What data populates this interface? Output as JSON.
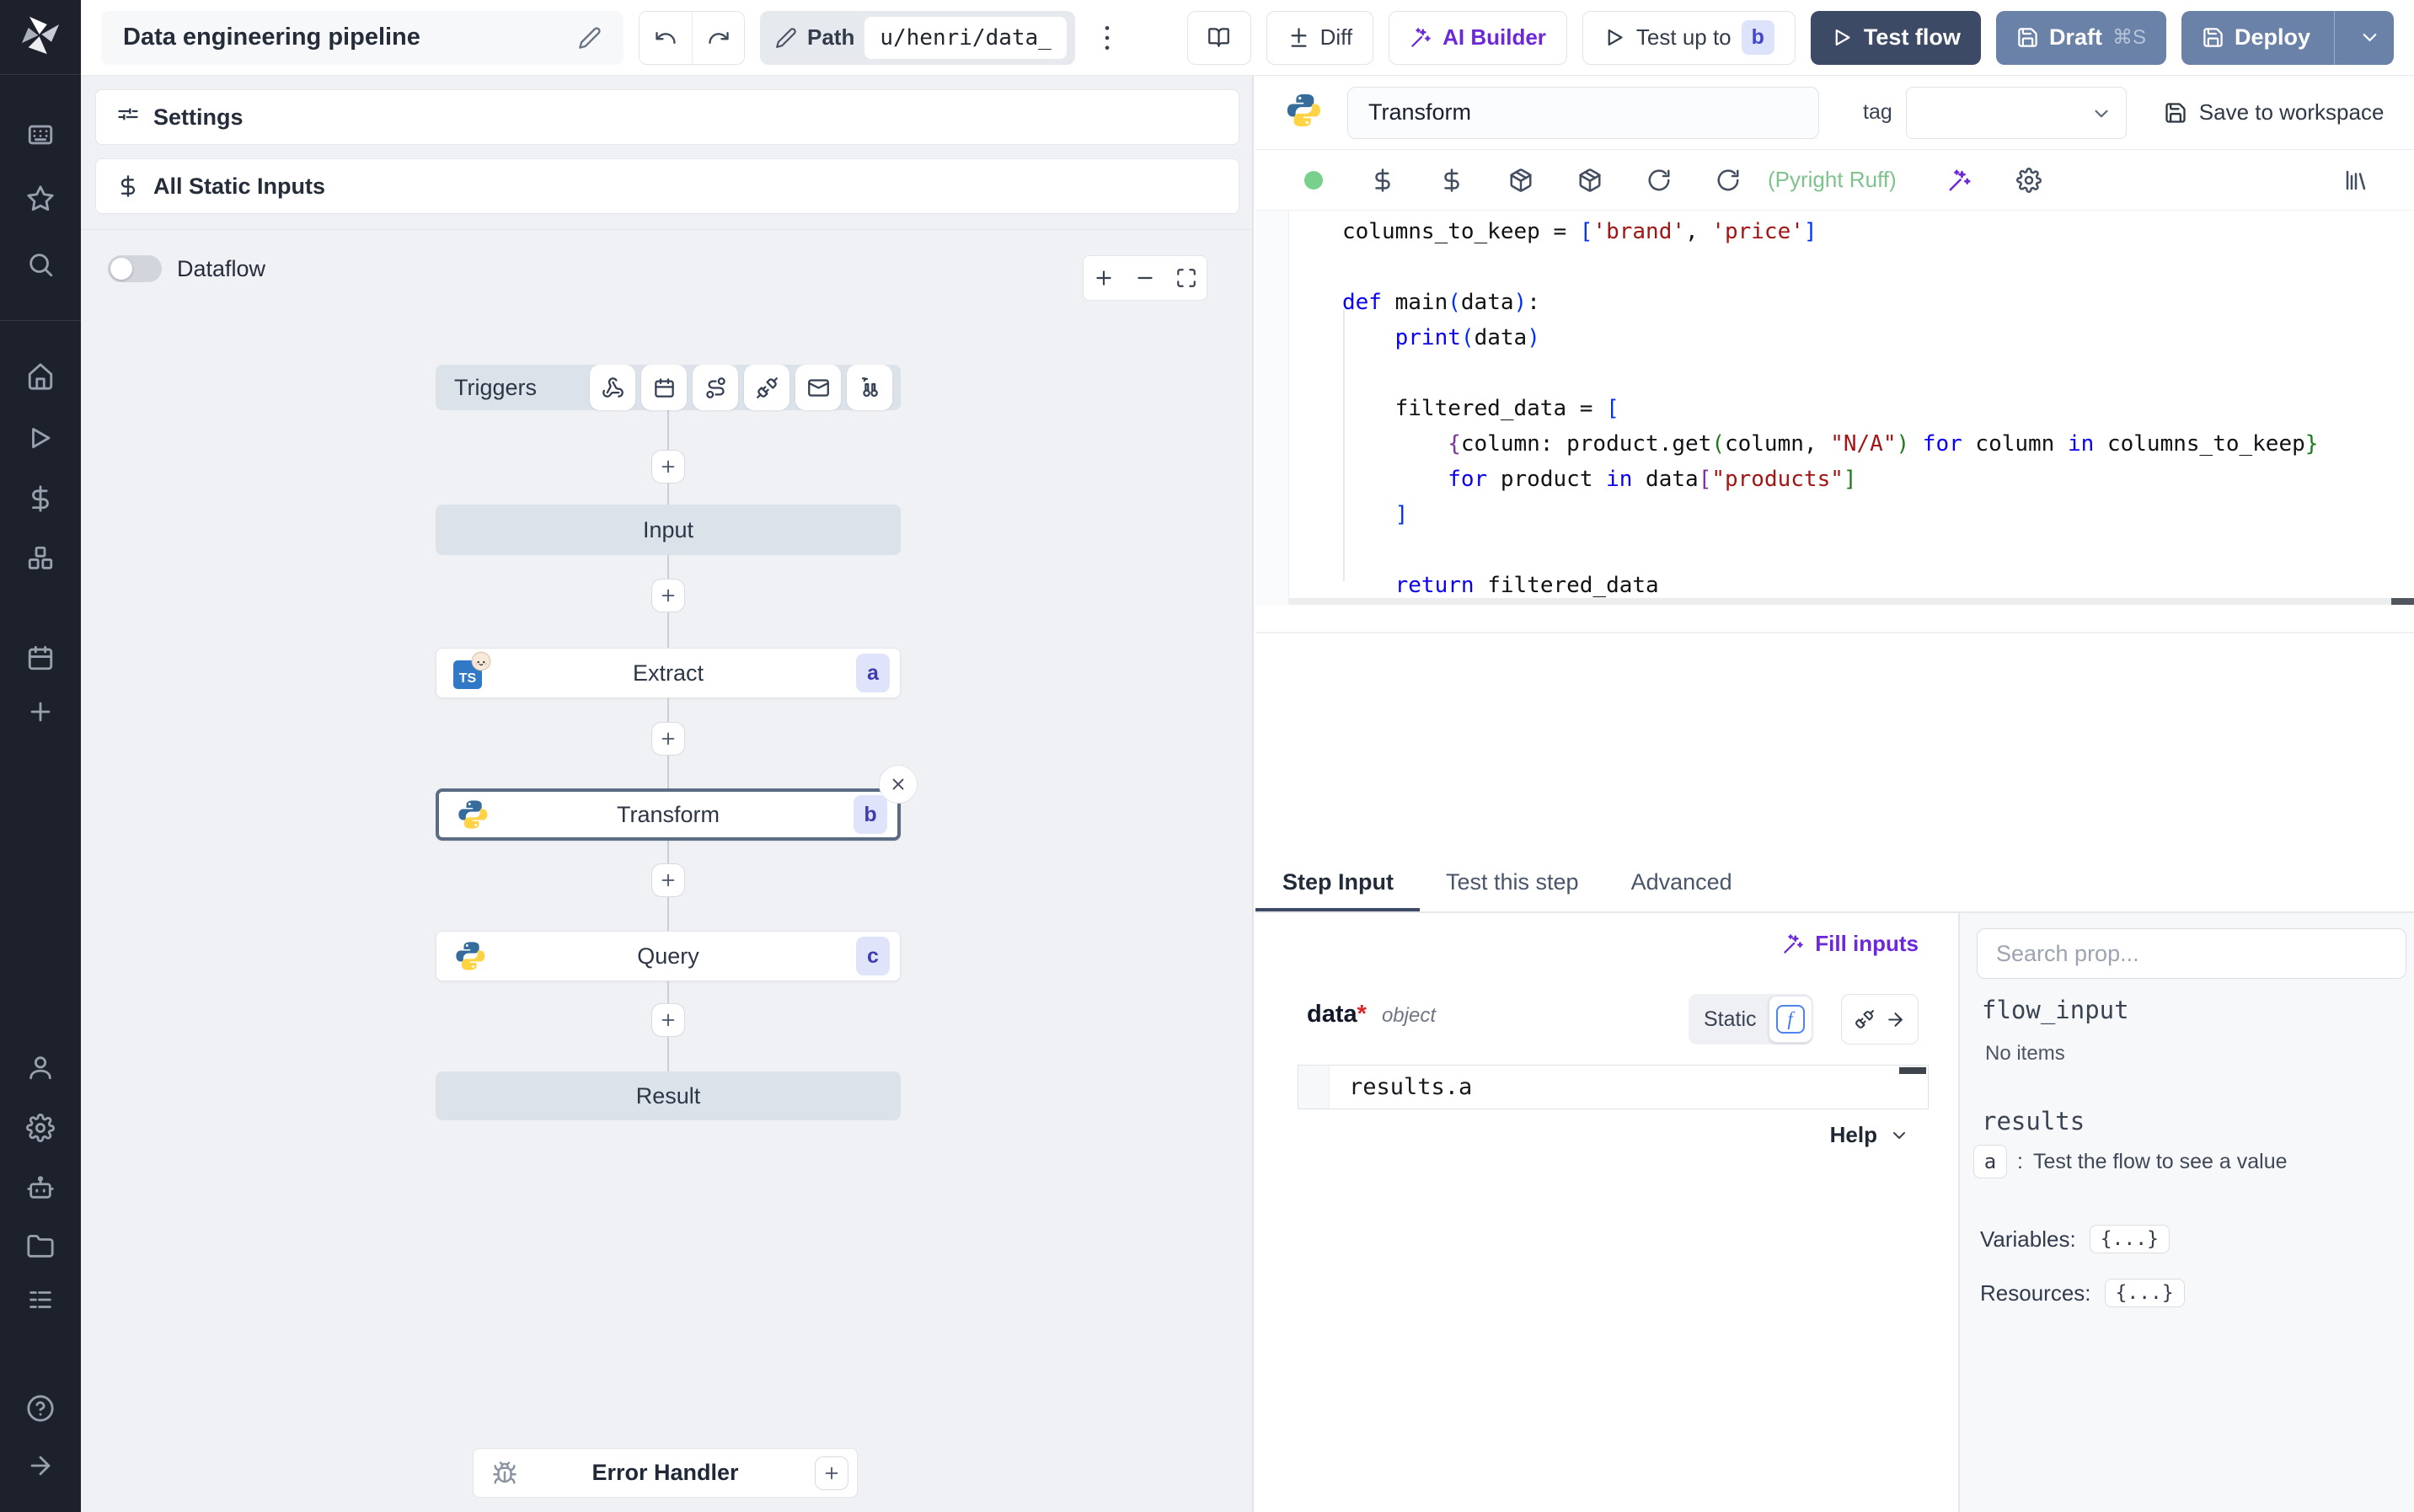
{
  "topbar": {
    "title": "Data engineering pipeline",
    "path_label": "Path",
    "path_value": "u/henri/data_",
    "diff_label": "Diff",
    "ai_builder_label": "AI Builder",
    "test_up_to_label": "Test up to",
    "test_up_to_badge": "b",
    "test_flow_label": "Test flow",
    "draft_label": "Draft",
    "draft_shortcut": "⌘S",
    "deploy_label": "Deploy"
  },
  "flow": {
    "settings_label": "Settings",
    "all_static_inputs_label": "All Static Inputs",
    "dataflow_label": "Dataflow",
    "triggers_label": "Triggers",
    "input_label": "Input",
    "extract": {
      "label": "Extract",
      "badge": "a"
    },
    "transform": {
      "label": "Transform",
      "badge": "b"
    },
    "query": {
      "label": "Query",
      "badge": "c"
    },
    "result_label": "Result",
    "error_handler_label": "Error Handler"
  },
  "editor": {
    "step_name": "Transform",
    "tag_label": "tag",
    "save_to_workspace_label": "Save to workspace",
    "lint_status": "(Pyright Ruff)",
    "code_lines": [
      [
        [
          "p",
          "columns_to_keep = "
        ],
        [
          "b1",
          "["
        ],
        [
          "s",
          "'brand'"
        ],
        [
          "p",
          ", "
        ],
        [
          "s",
          "'price'"
        ],
        [
          "b1",
          "]"
        ]
      ],
      [],
      [
        [
          "k",
          "def "
        ],
        [
          "p",
          "main"
        ],
        [
          "b1",
          "("
        ],
        [
          "p",
          "data"
        ],
        [
          "b1",
          ")"
        ],
        [
          "p",
          ":"
        ]
      ],
      [
        [
          "p",
          "    "
        ],
        [
          "k",
          "print"
        ],
        [
          "b1",
          "("
        ],
        [
          "p",
          "data"
        ],
        [
          "b1",
          ")"
        ]
      ],
      [],
      [
        [
          "p",
          "    filtered_data = "
        ],
        [
          "b1",
          "["
        ]
      ],
      [
        [
          "p",
          "        "
        ],
        [
          "b2",
          "{"
        ],
        [
          "p",
          "column: product.get"
        ],
        [
          "b3",
          "("
        ],
        [
          "p",
          "column, "
        ],
        [
          "s",
          "\"N/A\""
        ],
        [
          "b3",
          ")"
        ],
        [
          "p",
          " "
        ],
        [
          "k",
          "for"
        ],
        [
          "p",
          " column "
        ],
        [
          "k",
          "in"
        ],
        [
          "p",
          " columns_to_keep"
        ],
        [
          "b3",
          "}"
        ]
      ],
      [
        [
          "p",
          "        "
        ],
        [
          "k",
          "for"
        ],
        [
          "p",
          " product "
        ],
        [
          "k",
          "in"
        ],
        [
          "p",
          " data"
        ],
        [
          "b2",
          "["
        ],
        [
          "s",
          "\"products\""
        ],
        [
          "b3",
          "]"
        ]
      ],
      [
        [
          "p",
          "    "
        ],
        [
          "b1",
          "]"
        ]
      ],
      [],
      [
        [
          "p",
          "    "
        ],
        [
          "k",
          "return"
        ],
        [
          "p",
          " filtered_data"
        ]
      ]
    ]
  },
  "panel": {
    "tabs": {
      "step_input": "Step Input",
      "test_this_step": "Test this step",
      "advanced": "Advanced"
    },
    "fill_inputs_label": "Fill inputs",
    "field": {
      "name": "data",
      "required_mark": "*",
      "type": "object"
    },
    "static_label": "Static",
    "expr_value": "results.a",
    "help_label": "Help"
  },
  "props": {
    "search_placeholder": "Search prop...",
    "flow_input_label": "flow_input",
    "flow_input_empty": "No items",
    "results_label": "results",
    "result_key": "a",
    "result_separator": ":",
    "result_hint": "Test the flow to see a value",
    "variables_label": "Variables:",
    "variables_value": "{...}",
    "resources_label": "Resources:",
    "resources_value": "{...}"
  },
  "colors": {
    "accent_purple": "#6d28d9",
    "test_flow_bg": "#3d4a66",
    "deploy_bg": "#6b82a8",
    "badge_bg": "#e0e4fa",
    "badge_text": "#3f3dae",
    "status_green": "#77d08c",
    "lint_green": "#7fc28e",
    "node_gray": "#dbe2ea",
    "sidebar_bg": "#1d212c"
  }
}
